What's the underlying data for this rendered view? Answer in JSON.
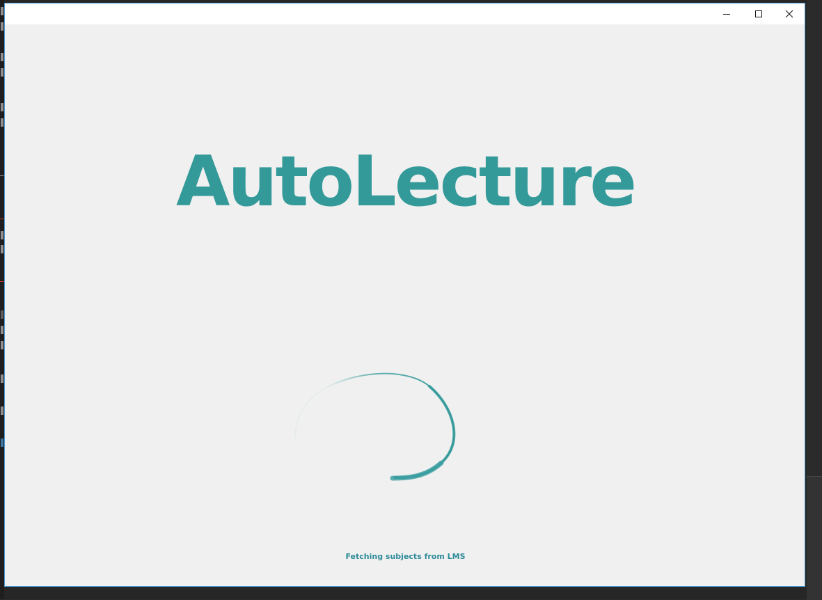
{
  "window": {
    "title": "",
    "controls": {
      "minimize_icon": "minimize-icon",
      "maximize_icon": "maximize-icon",
      "close_icon": "close-icon"
    }
  },
  "splash": {
    "app_name": "AutoLecture",
    "status": "Fetching subjects from LMS",
    "spinner_icon": "loading-spinner-icon"
  },
  "colors": {
    "accent": "#339999",
    "background": "#f0f0f0",
    "titlebar": "#ffffff",
    "window_border": "#4a9bd8"
  }
}
